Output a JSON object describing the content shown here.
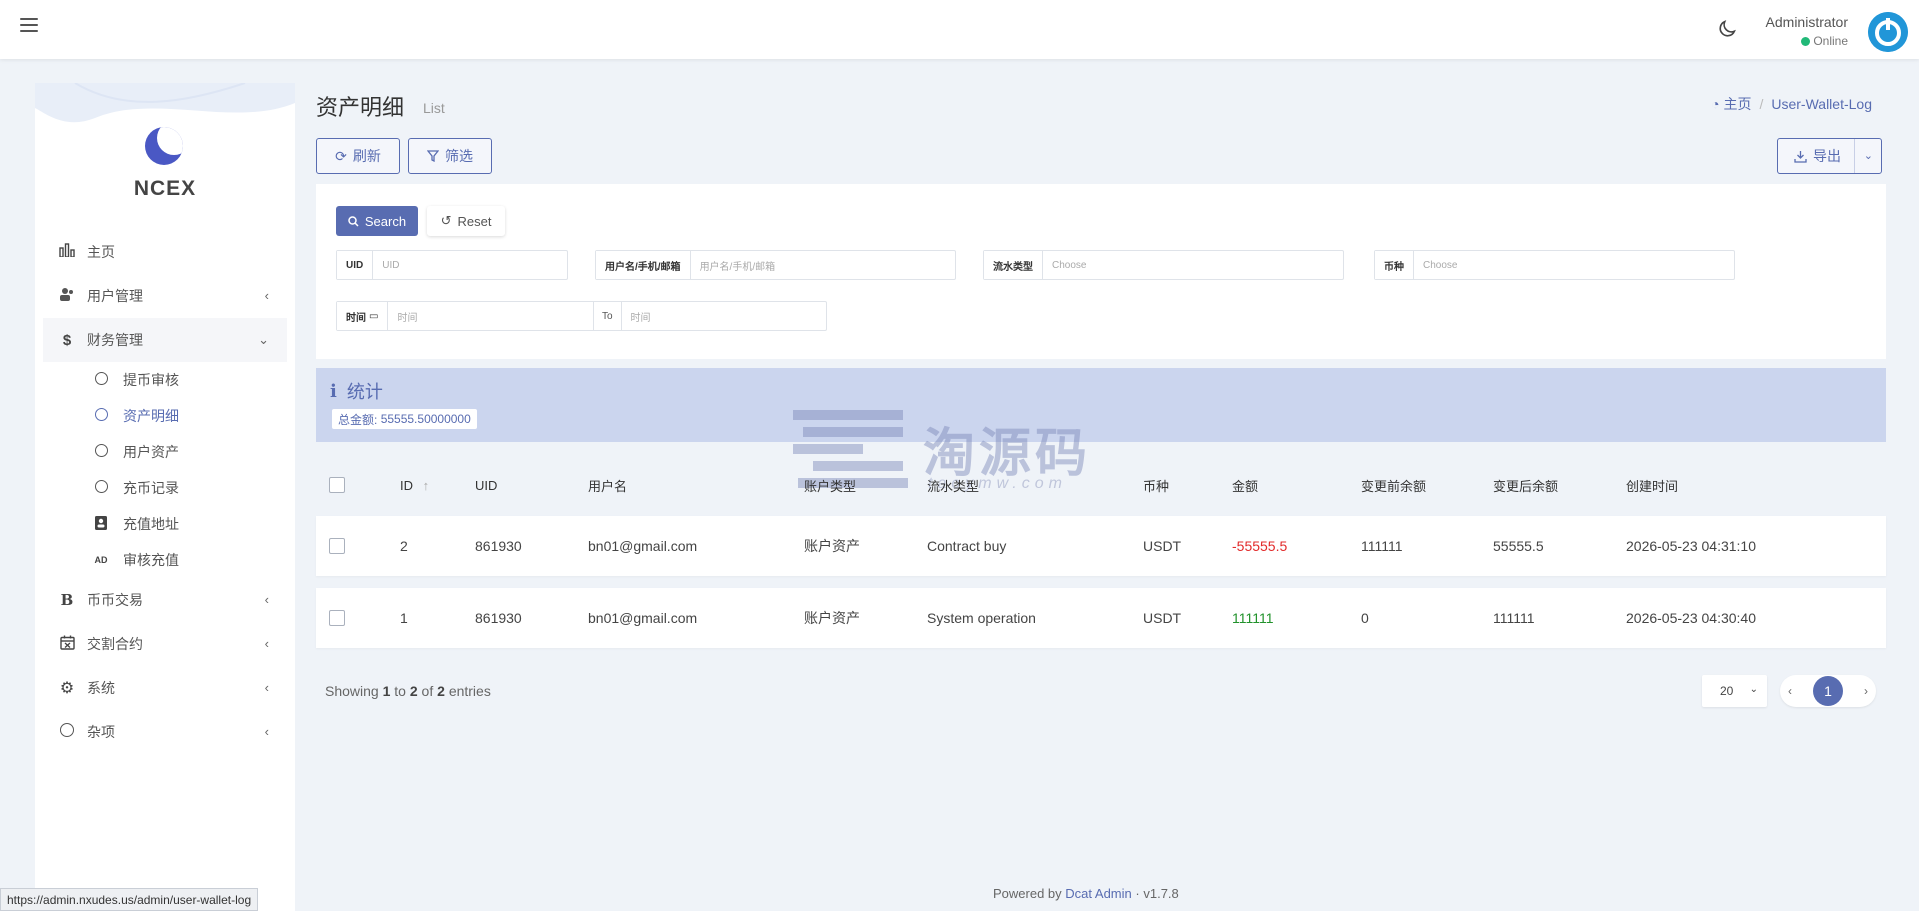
{
  "topbar": {
    "user_name": "Administrator",
    "user_status": "Online"
  },
  "sidebar": {
    "logo_text": "NCEX",
    "items": [
      {
        "label": "主页",
        "icon": "bar-chart-icon"
      },
      {
        "label": "用户管理",
        "icon": "users-icon"
      },
      {
        "label": "财务管理",
        "icon": "dollar-icon"
      },
      {
        "label": "币币交易",
        "icon": "bitcoin-icon"
      },
      {
        "label": "交割合约",
        "icon": "calendar-x-icon"
      },
      {
        "label": "系统",
        "icon": "gear-icon"
      },
      {
        "label": "杂项",
        "icon": "circle-icon"
      }
    ],
    "sub_items": [
      {
        "label": "提币审核",
        "icon": "circle-icon"
      },
      {
        "label": "资产明细",
        "icon": "circle-icon"
      },
      {
        "label": "用户资产",
        "icon": "circle-icon"
      },
      {
        "label": "充币记录",
        "icon": "circle-icon"
      },
      {
        "label": "充值地址",
        "icon": "contact-icon"
      },
      {
        "label": "审核充值",
        "icon": "ad-icon"
      }
    ]
  },
  "header": {
    "title": "资产明细",
    "subtitle": "List",
    "breadcrumb_home": "主页",
    "breadcrumb_current": "User-Wallet-Log"
  },
  "toolbar": {
    "refresh_label": "刷新",
    "filter_label": "筛选",
    "export_label": "导出"
  },
  "filters": {
    "search_label": "Search",
    "reset_label": "Reset",
    "uid_label": "UID",
    "uid_placeholder": "UID",
    "user_label": "用户名/手机/邮箱",
    "user_placeholder": "用户名/手机/邮箱",
    "flow_label": "流水类型",
    "flow_placeholder": "Choose",
    "coin_label": "币种",
    "coin_placeholder": "Choose",
    "time_label": "时间",
    "time_start_placeholder": "时间",
    "time_to": "To",
    "time_end_placeholder": "时间"
  },
  "stats": {
    "title": "统计",
    "total_label": "总金额:",
    "total_value": "55555.50000000"
  },
  "watermark": {
    "text": "淘源码",
    "url": "taoymw.com"
  },
  "table": {
    "headers": [
      "ID",
      "UID",
      "用户名",
      "账户类型",
      "流水类型",
      "币种",
      "金额",
      "变更前余额",
      "变更后余额",
      "创建时间"
    ],
    "rows": [
      {
        "id": "2",
        "uid": "861930",
        "username": "bn01@gmail.com",
        "account_type": "账户资产",
        "flow_type": "Contract buy",
        "coin": "USDT",
        "amount": "-55555.5",
        "before": "111111",
        "after": "55555.5",
        "created": "2026-05-23 04:31:10"
      },
      {
        "id": "1",
        "uid": "861930",
        "username": "bn01@gmail.com",
        "account_type": "账户资产",
        "flow_type": "System operation",
        "coin": "USDT",
        "amount": "111111",
        "before": "0",
        "after": "111111",
        "created": "2026-05-23 04:30:40"
      }
    ]
  },
  "pagination": {
    "showing_prefix": "Showing",
    "from": "1",
    "to_word": "to",
    "to": "2",
    "of_word": "of",
    "total": "2",
    "entries_word": "entries",
    "per_page": "20",
    "current_page": "1"
  },
  "footer": {
    "powered_by": "Powered by",
    "brand": "Dcat Admin",
    "dot": "·",
    "version": "v1.7.8"
  },
  "status_url": "https://admin.nxudes.us/admin/user-wallet-log",
  "colors": {
    "accent": "#586cb1",
    "negative": "#e22b2b",
    "positive": "#21922b",
    "stats_bg": "#cbd5ee"
  }
}
